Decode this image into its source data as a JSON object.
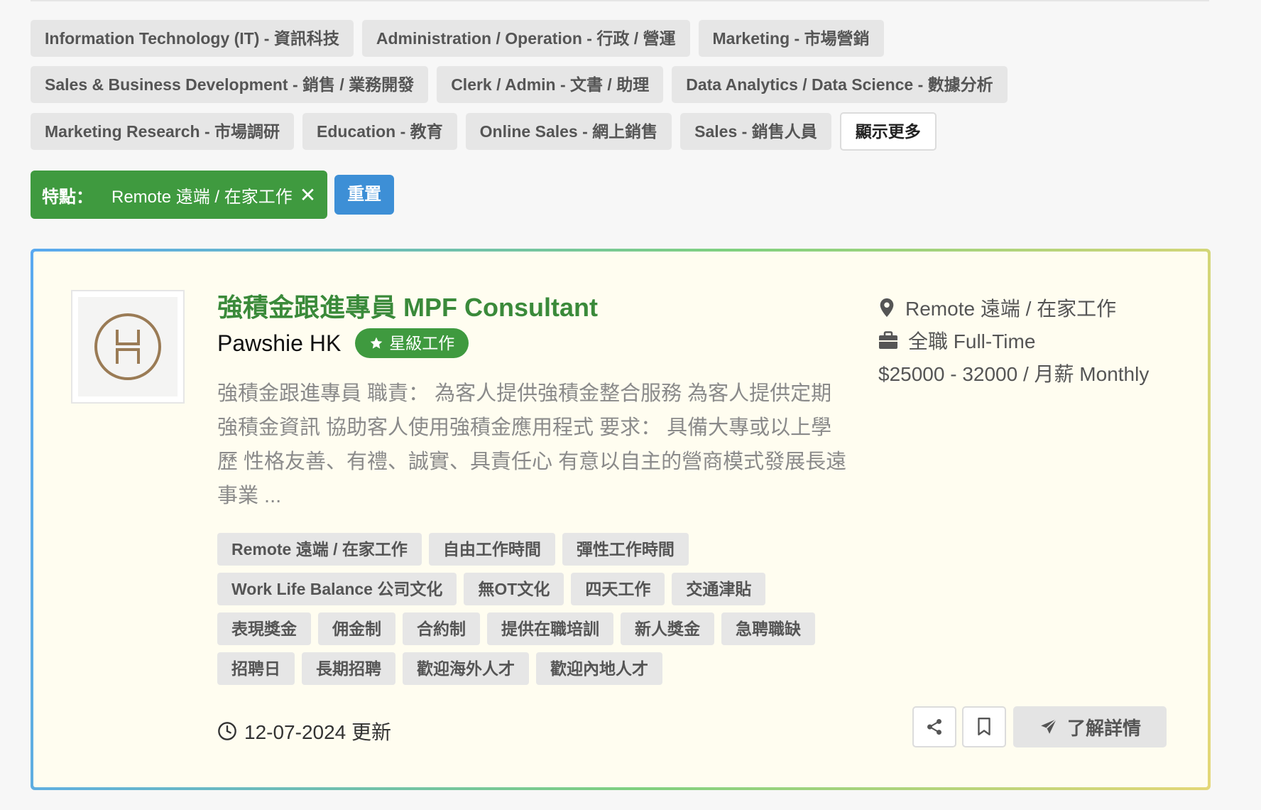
{
  "categories": {
    "rows": [
      [
        "Information Technology (IT) - 資訊科技",
        "Administration / Operation - 行政 / 營運",
        "Marketing - 市場營銷"
      ],
      [
        "Sales & Business Development - 銷售 / 業務開發",
        "Clerk / Admin - 文書 / 助理",
        "Data Analytics / Data Science - 數據分析"
      ],
      [
        "Marketing Research - 市場調研",
        "Education - 教育",
        "Online Sales - 網上銷售",
        "Sales - 銷售人員"
      ]
    ],
    "show_more": "顯示更多"
  },
  "active_filter": {
    "label": "特點：",
    "value": "Remote 遠端 / 在家工作",
    "close": "✕"
  },
  "reset_label": "重置",
  "job": {
    "title": "強積金跟進專員 MPF Consultant",
    "company": "Pawshie HK",
    "badge": "星級工作",
    "description": "強積金跟進專員 職責：  為客人提供強積金整合服務 為客人提供定期強積金資訊 協助客人使用強積金應用程式 要求：  具備大專或以上學歷 性格友善、有禮、誠實、具責任心 有意以自主的營商模式發展長遠事業 ...",
    "location": "Remote 遠端 / 在家工作",
    "employment_type": "全職 Full-Time",
    "salary": "$25000 - 32000 / 月薪 Monthly",
    "tag_rows": [
      [
        "Remote 遠端 / 在家工作",
        "自由工作時間",
        "彈性工作時間"
      ],
      [
        "Work Life Balance 公司文化",
        "無OT文化",
        "四天工作",
        "交通津貼"
      ],
      [
        "表現獎金",
        "佣金制",
        "合約制",
        "提供在職培訓",
        "新人獎金",
        "急聘職缺"
      ],
      [
        "招聘日",
        "長期招聘",
        "歡迎海外人才",
        "歡迎內地人才"
      ]
    ],
    "updated": "12-07-2024 更新",
    "detail_button": "了解詳情"
  },
  "colors": {
    "green": "#3f9a3f",
    "blue": "#3d8fd6",
    "card_bg": "#fffdf0"
  }
}
